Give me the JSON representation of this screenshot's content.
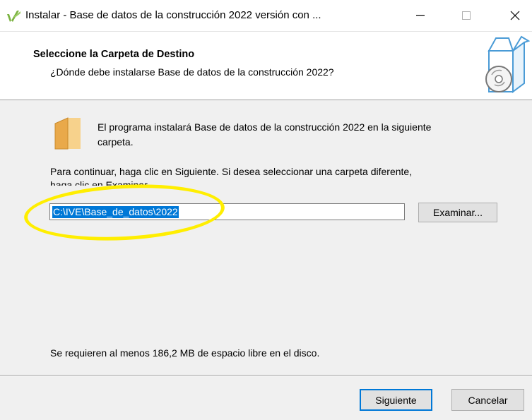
{
  "window": {
    "title": "Instalar - Base de datos de la construcción 2022 versión con ...",
    "minimize_glyph": "—",
    "maximize_glyph": "☐",
    "close_glyph": "✕"
  },
  "header": {
    "title": "Seleccione la Carpeta de Destino",
    "subtitle": "¿Dónde debe instalarse Base de datos de la construcción 2022?",
    "icon": "box-disc-icon"
  },
  "body": {
    "folder_icon": "folder-icon",
    "intro_line1": "El programa instalará Base de datos de la construcción 2022 en la siguiente",
    "intro_line2": "carpeta.",
    "continue_line1": "Para continuar, haga clic en Siguiente. Si desea seleccionar una carpeta diferente,",
    "continue_line2": "haga clic en Examinar.",
    "path_value": "C:\\IVE\\Base_de_datos\\2022",
    "browse_label": "Examinar...",
    "space_required": "Se requieren al menos 186,2 MB de espacio libre en el disco."
  },
  "footer": {
    "next_label": "Siguiente",
    "cancel_label": "Cancelar"
  },
  "colors": {
    "selection": "#0078d7",
    "annotation": "#ffee00",
    "folder": "#f5c878"
  }
}
